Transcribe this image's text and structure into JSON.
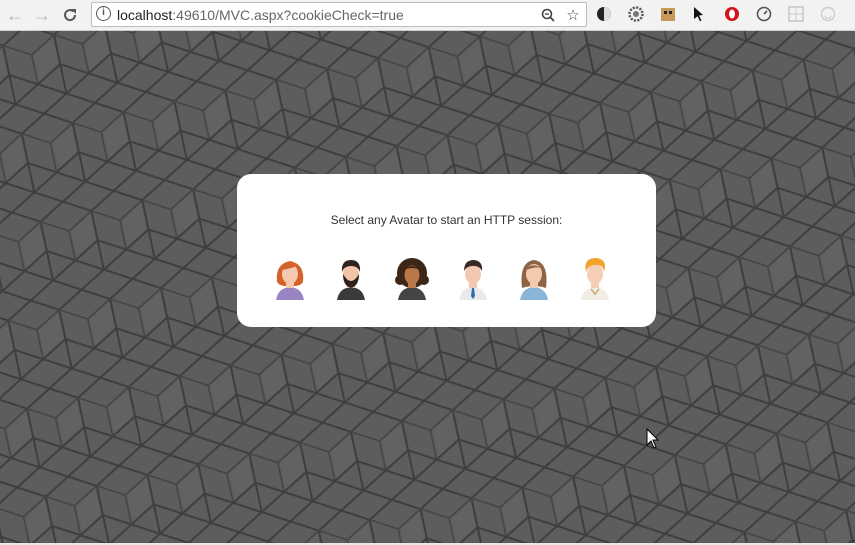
{
  "browser": {
    "url_host": "localhost",
    "url_rest": ":49610/MVC.aspx?cookieCheck=true",
    "nav": [
      "back-icon",
      "forward-icon",
      "reload-icon"
    ],
    "omnibox_icons": [
      "info-icon",
      "zoom-icon",
      "star-icon"
    ],
    "extensions": [
      "dark-mode-icon",
      "gear-extension-icon",
      "cardboard-extension-icon",
      "cursor-extension-icon",
      "opera-extension-icon",
      "speed-extension-icon",
      "grid-extension-icon",
      "smile-extension-icon"
    ]
  },
  "dialog": {
    "prompt": "Select any Avatar to start an HTTP session:",
    "avatars": [
      {
        "name": "avatar-red-hair-woman",
        "hair": "#d4622a",
        "skin": "#f5c9b0",
        "shirt": "#9a84c4"
      },
      {
        "name": "avatar-bearded-man",
        "hair": "#2e221c",
        "skin": "#f2c4a8",
        "shirt": "#3a3a3a"
      },
      {
        "name": "avatar-curly-hair-woman",
        "hair": "#3d2616",
        "skin": "#b9784a",
        "shirt": "#444444"
      },
      {
        "name": "avatar-man-tie",
        "hair": "#3a2a22",
        "skin": "#f4c8b0",
        "shirt": "#eaeaea"
      },
      {
        "name": "avatar-brown-hair-woman",
        "hair": "#8e6445",
        "skin": "#f5c9b0",
        "shirt": "#8ab4d8"
      },
      {
        "name": "avatar-blond-man",
        "hair": "#f1a32a",
        "skin": "#f6cdb6",
        "shirt": "#f1ede3"
      }
    ]
  },
  "colors": {
    "background": "#5c5c5c",
    "card": "#ffffff"
  }
}
